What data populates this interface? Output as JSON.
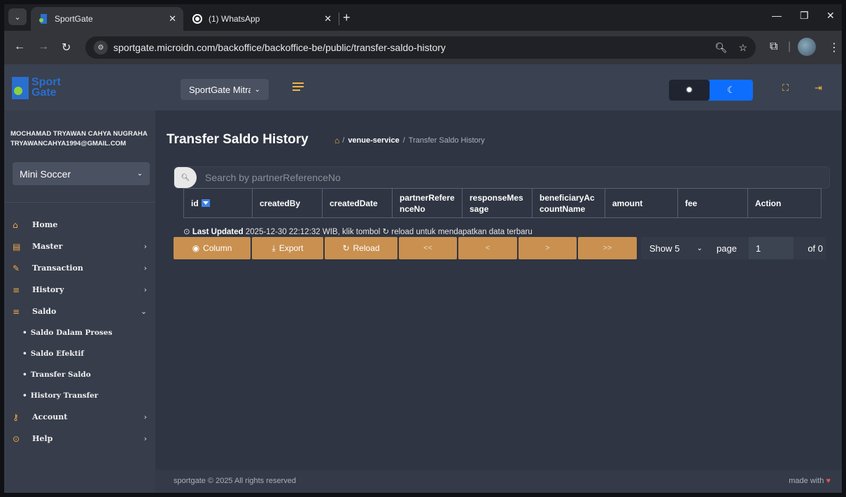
{
  "browser": {
    "tabs": [
      {
        "title": "SportGate",
        "active": true
      },
      {
        "title": "(1) WhatsApp",
        "active": false
      }
    ],
    "url": "sportgate.microidn.com/backoffice/backoffice-be/public/transfer-saldo-history",
    "new_tab": "+",
    "close": "✕"
  },
  "logo": {
    "line1": "Sport",
    "line2": "Gate"
  },
  "user": {
    "name": "MOCHAMAD TRYAWAN CAHYA NUGRAHA",
    "email": "TRYAWANCAHYA1994@GMAIL.COM"
  },
  "venue_select": {
    "value": "Mini Soccer"
  },
  "topbar": {
    "mitra_select": "SportGate Mitra"
  },
  "menu": [
    {
      "label": "Home",
      "icon": "home-icon"
    },
    {
      "label": "Master",
      "icon": "database-icon",
      "chevron": "›"
    },
    {
      "label": "Transaction",
      "icon": "edit-icon",
      "chevron": "›"
    },
    {
      "label": "History",
      "icon": "list-icon",
      "chevron": "›"
    },
    {
      "label": "Saldo",
      "icon": "list-icon",
      "chevron": "⌄"
    },
    {
      "label": "Account",
      "icon": "key-icon",
      "chevron": "›"
    },
    {
      "label": "Help",
      "icon": "help-icon",
      "chevron": "›"
    }
  ],
  "saldo_submenu": [
    "Saldo Dalam Proses",
    "Saldo Efektif",
    "Transfer Saldo",
    "History Transfer"
  ],
  "page": {
    "title": "Transfer Saldo History",
    "breadcrumb": {
      "sep": "/",
      "venue": "venue-service",
      "current": "Transfer Saldo History"
    }
  },
  "search": {
    "placeholder": "Search by partnerReferenceNo"
  },
  "table": {
    "headers": [
      "id",
      "createdBy",
      "createdDate",
      "partnerRefere nceNo",
      "responseMes sage",
      "beneficiaryAc countName",
      "amount",
      "fee",
      "Action"
    ]
  },
  "last_updated": {
    "label": "Last Updated",
    "text_before": "2025-12-30 22:12:32 WIB, klik tombol",
    "text_after": "reload untuk mendapatkan data terbaru"
  },
  "toolbar": {
    "column": "Column",
    "export": "Export",
    "reload": "Reload",
    "first": "<<",
    "prev": "<",
    "next": ">",
    "last": ">>",
    "show": "Show 5",
    "page_label": "page",
    "page_value": "1",
    "of": "of 0"
  },
  "footer": {
    "copyright": "sportgate © 2025 All rights reserved",
    "made_with": "made with"
  },
  "colors": {
    "accent": "#f5b342",
    "button": "#c99050",
    "primary": "#0d6efd",
    "sidebar": "#373d4a",
    "content": "#2f3542"
  }
}
